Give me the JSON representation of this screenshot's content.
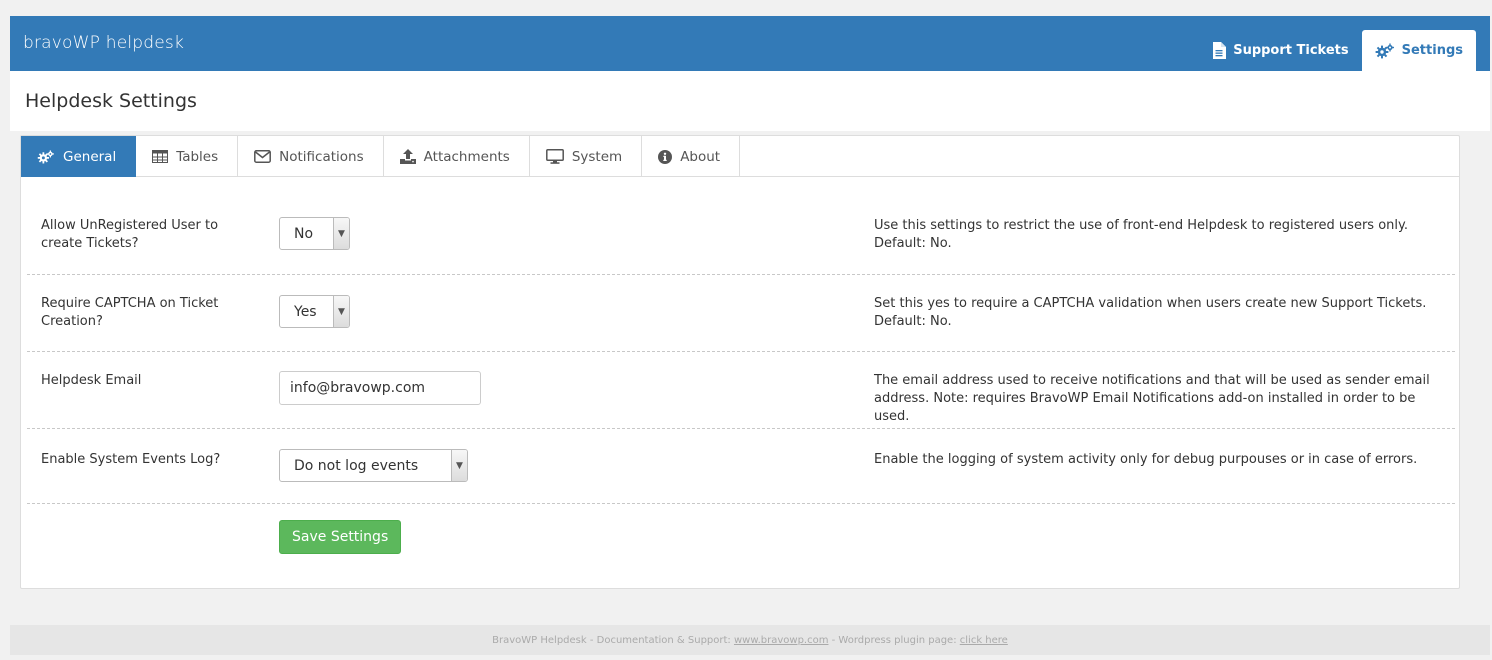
{
  "app": {
    "brand": "bravoWP helpdesk"
  },
  "topnav": {
    "items": [
      {
        "label": "Support Tickets",
        "icon": "file-icon",
        "active": false
      },
      {
        "label": "Settings",
        "icon": "gears-icon",
        "active": true
      }
    ]
  },
  "page": {
    "title": "Helpdesk Settings"
  },
  "tabs": [
    {
      "label": "General",
      "icon": "gears-icon",
      "active": true
    },
    {
      "label": "Tables",
      "icon": "table-icon"
    },
    {
      "label": "Notifications",
      "icon": "envelope-icon"
    },
    {
      "label": "Attachments",
      "icon": "upload-icon"
    },
    {
      "label": "System",
      "icon": "monitor-icon"
    },
    {
      "label": "About",
      "icon": "info-icon"
    }
  ],
  "settings": [
    {
      "label": "Allow UnRegistered User to create Tickets?",
      "value": "No",
      "description": "Use this settings to restrict the use of front-end Helpdesk to registered users only. Default: No."
    },
    {
      "label": "Require CAPTCHA on Ticket Creation?",
      "value": "Yes",
      "description": "Set this yes to require a CAPTCHA validation when users create new Support Tickets. Default: No."
    },
    {
      "label": "Helpdesk Email",
      "value": "info@bravowp.com",
      "description": "The email address used to receive notifications and that will be used as sender email address. Note: requires BravoWP Email Notifications add-on installed in order to be used."
    },
    {
      "label": "Enable System Events Log?",
      "value": "Do not log events",
      "description": "Enable the logging of system activity only for debug purpouses or in case of errors."
    }
  ],
  "actions": {
    "save_label": "Save Settings"
  },
  "footer": {
    "text1": "BravoWP Helpdesk - Documentation & Support: ",
    "link1": "www.bravowp.com",
    "text2": " - Wordpress plugin page: ",
    "link2": "click here"
  },
  "colors": {
    "brand": "#337ab7",
    "save": "#5cb85c"
  }
}
